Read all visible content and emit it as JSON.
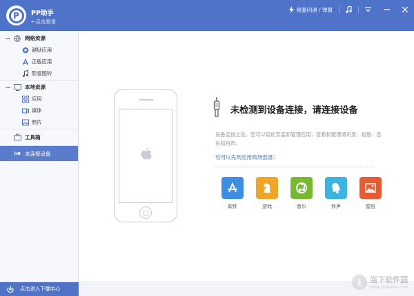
{
  "header": {
    "app_name": "PP助手",
    "login_link": "←点击登录",
    "repair_link": "修复闪退 / 弹窗"
  },
  "sidebar": {
    "groups": [
      {
        "label": "网络资源",
        "toggle": "—",
        "items": [
          {
            "label": "越狱应用"
          },
          {
            "label": "正版应用"
          },
          {
            "label": "影音图铃"
          }
        ]
      },
      {
        "label": "本地资源",
        "toggle": "—",
        "items": [
          {
            "label": "应用"
          },
          {
            "label": "媒体"
          },
          {
            "label": "照片"
          }
        ]
      }
    ],
    "toolbox": "工具箱",
    "device": "未连接设备"
  },
  "main": {
    "headline": "未检测到设备连接，请连接设备",
    "description": "设备连接之后，您可以轻松安装和管理应用，查看和整理通讯录、相册、音乐和铃声。",
    "shop_link": "也可以先到应用商场逛逛：",
    "apps": [
      {
        "label": "软件",
        "color": "#3d8ee0"
      },
      {
        "label": "游戏",
        "color": "#f0a528"
      },
      {
        "label": "音乐",
        "color": "#79b833"
      },
      {
        "label": "铃声",
        "color": "#3db3e0"
      },
      {
        "label": "壁纸",
        "color": "#e85a2f"
      }
    ]
  },
  "footer": {
    "download_center": "点击进入下载中心",
    "watermark_title": "当下软件园",
    "watermark_url": "www.downxia.com"
  },
  "colors": {
    "accent": "#4e73c9",
    "sidebar_active": "#5b7ccc",
    "link": "#3a84d8"
  }
}
